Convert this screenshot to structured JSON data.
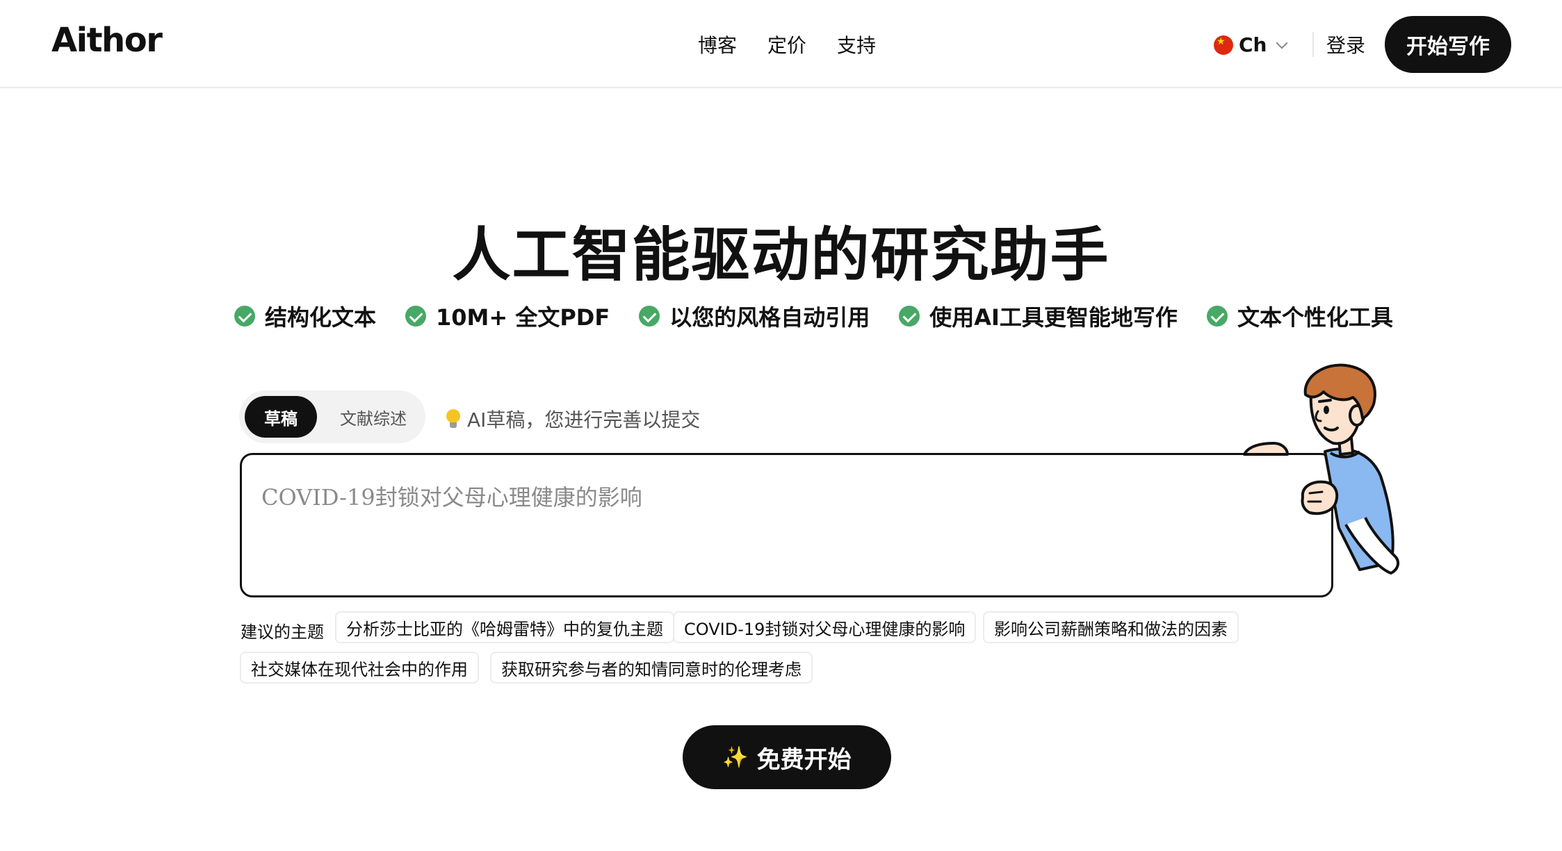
{
  "header": {
    "logo": "Aithor",
    "nav": [
      {
        "label": "博客"
      },
      {
        "label": "定价"
      },
      {
        "label": "支持"
      }
    ],
    "language": {
      "label": "Ch",
      "flag_icon": "china-flag-icon"
    },
    "login": "登录",
    "start_writing": "开始写作"
  },
  "hero": {
    "title": "人工智能驱动的研究助手",
    "features": [
      {
        "label": "结构化文本"
      },
      {
        "label": "10M+ 全文PDF"
      },
      {
        "label": "以您的风格自动引用"
      },
      {
        "label": "使用AI工具更智能地写作"
      },
      {
        "label": "文本个性化工具"
      }
    ]
  },
  "mode_toggle": {
    "active": "草稿",
    "inactive": "文献综述"
  },
  "hint": "AI草稿，您进行完善以提交",
  "topic_input": {
    "placeholder": "COVID-19封锁对父母心理健康的影响",
    "value": ""
  },
  "suggestions": {
    "label": "建议的主题",
    "items": [
      {
        "label": "分析莎士比亚的《哈姆雷特》中的复仇主题"
      },
      {
        "label": "COVID-19封锁对父母心理健康的影响"
      },
      {
        "label": "影响公司薪酬策略和做法的因素"
      },
      {
        "label": "社交媒体在现代社会中的作用"
      },
      {
        "label": "获取研究参与者的知情同意时的伦理考虑"
      }
    ]
  },
  "cta": {
    "label": "免费开始",
    "icon": "sparkle-icon"
  },
  "colors": {
    "accent": "#111111",
    "check_green": "#48a866",
    "bulb_yellow": "#f5c423",
    "mascot_shirt": "#8ab8f0",
    "mascot_hair": "#c8733a"
  }
}
